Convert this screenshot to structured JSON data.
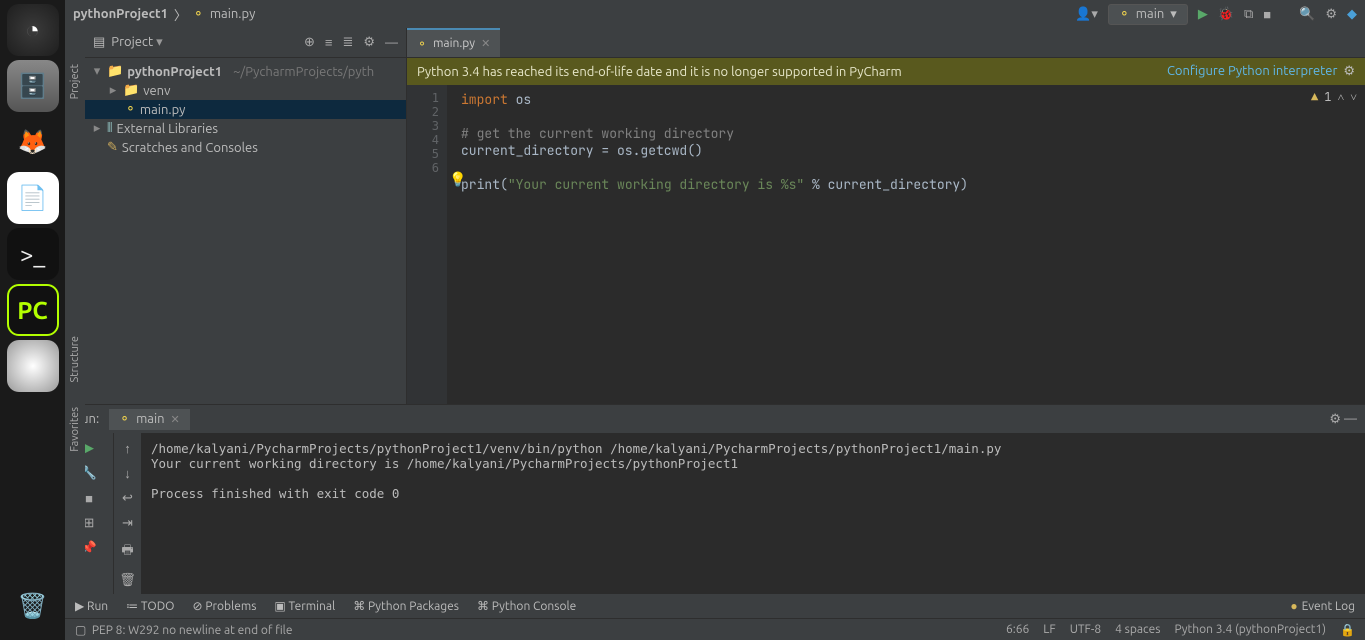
{
  "breadcrumb": {
    "project": "pythonProject1",
    "file": "main.py"
  },
  "toolbar": {
    "runconfig": "main"
  },
  "project_panel": {
    "title": "Project",
    "root": "pythonProject1",
    "root_path": "~/PycharmProjects/pyth",
    "venv": "venv",
    "mainfile": "main.py",
    "ext_libs": "External Libraries",
    "scratches": "Scratches and Consoles"
  },
  "vgutter": {
    "project": "Project",
    "structure": "Structure",
    "favorites": "Favorites"
  },
  "editor": {
    "tab": "main.py",
    "eol_banner": "Python 3.4 has reached its end-of-life date and it is no longer supported in PyCharm",
    "eol_link": "Configure Python interpreter",
    "inspection_count": "1",
    "lines": [
      "1",
      "2",
      "3",
      "4",
      "5",
      "6"
    ],
    "code": {
      "l1_kw": "import",
      "l1_id": " os",
      "l3_comment": "# get the current working directory",
      "l4": "current_directory = os.getcwd()",
      "l6_fn": "print",
      "l6_p1": "(",
      "l6_str": "\"Your current working directory is %s\"",
      "l6_rest": " % current_directory)"
    }
  },
  "run": {
    "label": "Run:",
    "tab": "main",
    "output_cmd": "/home/kalyani/PycharmProjects/pythonProject1/venv/bin/python /home/kalyani/PycharmProjects/pythonProject1/main.py",
    "output_line": "Your current working directory is /home/kalyani/PycharmProjects/pythonProject1",
    "exit": "Process finished with exit code 0"
  },
  "bottom": {
    "run": "Run",
    "todo": "TODO",
    "problems": "Problems",
    "terminal": "Terminal",
    "packages": "Python Packages",
    "console": "Python Console",
    "eventlog": "Event Log"
  },
  "status": {
    "hint": "PEP 8: W292 no newline at end of file",
    "pos": "6:66",
    "le": "LF",
    "enc": "UTF-8",
    "indent": "4 spaces",
    "interp": "Python 3.4 (pythonProject1)"
  }
}
